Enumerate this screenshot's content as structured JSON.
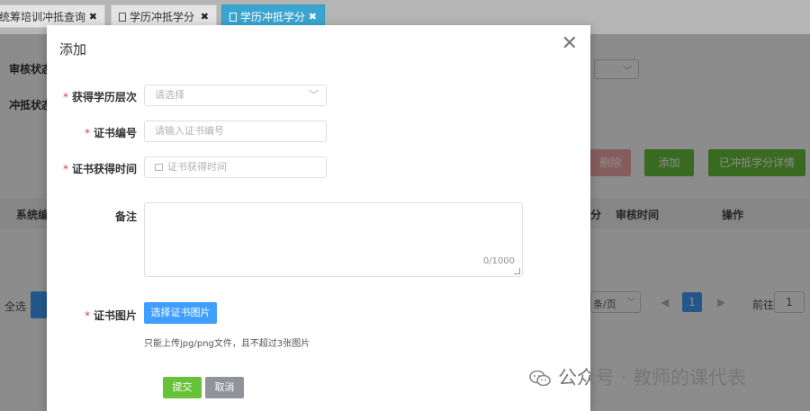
{
  "tabs": [
    {
      "label": "统筹培训冲抵查询",
      "active": false
    },
    {
      "label": "学历冲抵学分",
      "active": false
    },
    {
      "label": "学历冲抵学分",
      "active": true
    }
  ],
  "background": {
    "filter_labels": [
      "审核状态",
      "冲抵状态"
    ],
    "buttons": {
      "delete": "删除",
      "add": "添加",
      "detail": "已冲抵学分详情"
    },
    "table_headers": [
      "系统编",
      "分",
      "审核时间",
      "操作"
    ],
    "select_all": "全选",
    "pager": {
      "page_size": "条/页",
      "current_page": "1",
      "goto_label": "前往",
      "goto_value": "1"
    }
  },
  "dialog": {
    "title": "添加",
    "fields": {
      "level": {
        "label": "获得学历层次",
        "placeholder": "请选择",
        "required": true
      },
      "cert_no": {
        "label": "证书编号",
        "placeholder": "请输入证书编号",
        "required": true
      },
      "cert_date": {
        "label": "证书获得时间",
        "placeholder": "证书获得时间",
        "required": true
      },
      "remark": {
        "label": "备注",
        "counter": "0/1000",
        "required": false
      },
      "cert_image": {
        "label": "证书图片",
        "button": "选择证书图片",
        "hint": "只能上传jpg/png文件，且不超过3张图片",
        "required": true
      }
    },
    "submit": "提交",
    "cancel": "取消"
  },
  "watermark": {
    "text": "公众号 · 教师的课代表",
    "icon": "wechat-icon"
  },
  "colors": {
    "tab_active": "#3aa6cf",
    "primary_blue": "#409eff",
    "success_green": "#67c23a",
    "cancel_gray": "#909399",
    "danger_light": "#f5a9a9",
    "required_star": "#e4393c"
  }
}
